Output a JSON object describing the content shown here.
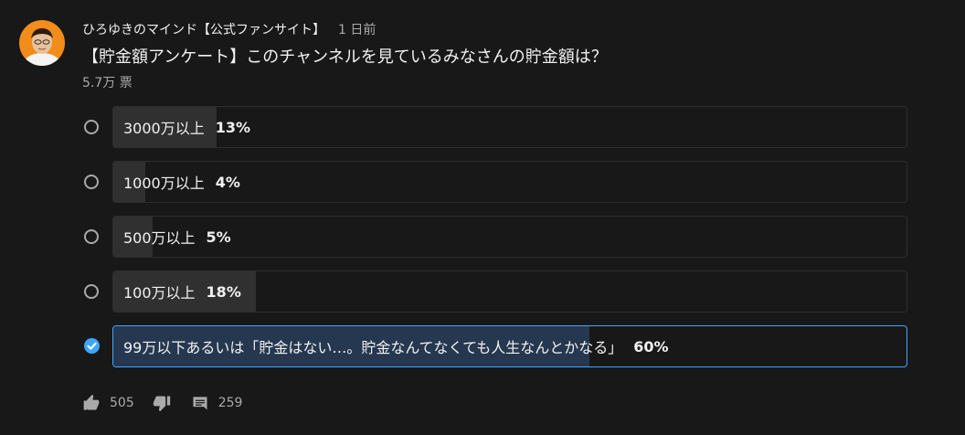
{
  "post": {
    "channel_name": "ひろゆきのマインド【公式ファンサイト】",
    "time": "1 日前",
    "text": "【貯金額アンケート】このチャンネルを見ているみなさんの貯金額は？",
    "votes": "5.7万 票"
  },
  "poll": {
    "options": [
      {
        "label": "3000万以上",
        "percent": "13%",
        "fraction": 0.13,
        "selected": false
      },
      {
        "label": "1000万以上",
        "percent": "4%",
        "fraction": 0.04,
        "selected": false
      },
      {
        "label": "500万以上",
        "percent": "5%",
        "fraction": 0.05,
        "selected": false
      },
      {
        "label": "100万以上",
        "percent": "18%",
        "fraction": 0.18,
        "selected": false
      },
      {
        "label": "99万以下あるいは「貯金はない…。貯金なんてなくても人生なんとかなる」",
        "percent": "60%",
        "fraction": 0.6,
        "selected": true
      }
    ]
  },
  "footer": {
    "likes": "505",
    "comments": "259"
  },
  "icons": {
    "avatar": "avatar-image",
    "like": "thumbs-up-icon",
    "dislike": "thumbs-down-icon",
    "comment": "comment-icon",
    "radio": "radio-button-icon",
    "check": "check-circle-icon"
  },
  "colors": {
    "background": "#181818",
    "accent": "#3ea6ff",
    "fill": "#303030",
    "selected_fill": "#263850",
    "muted_text": "#aaaaaa"
  }
}
